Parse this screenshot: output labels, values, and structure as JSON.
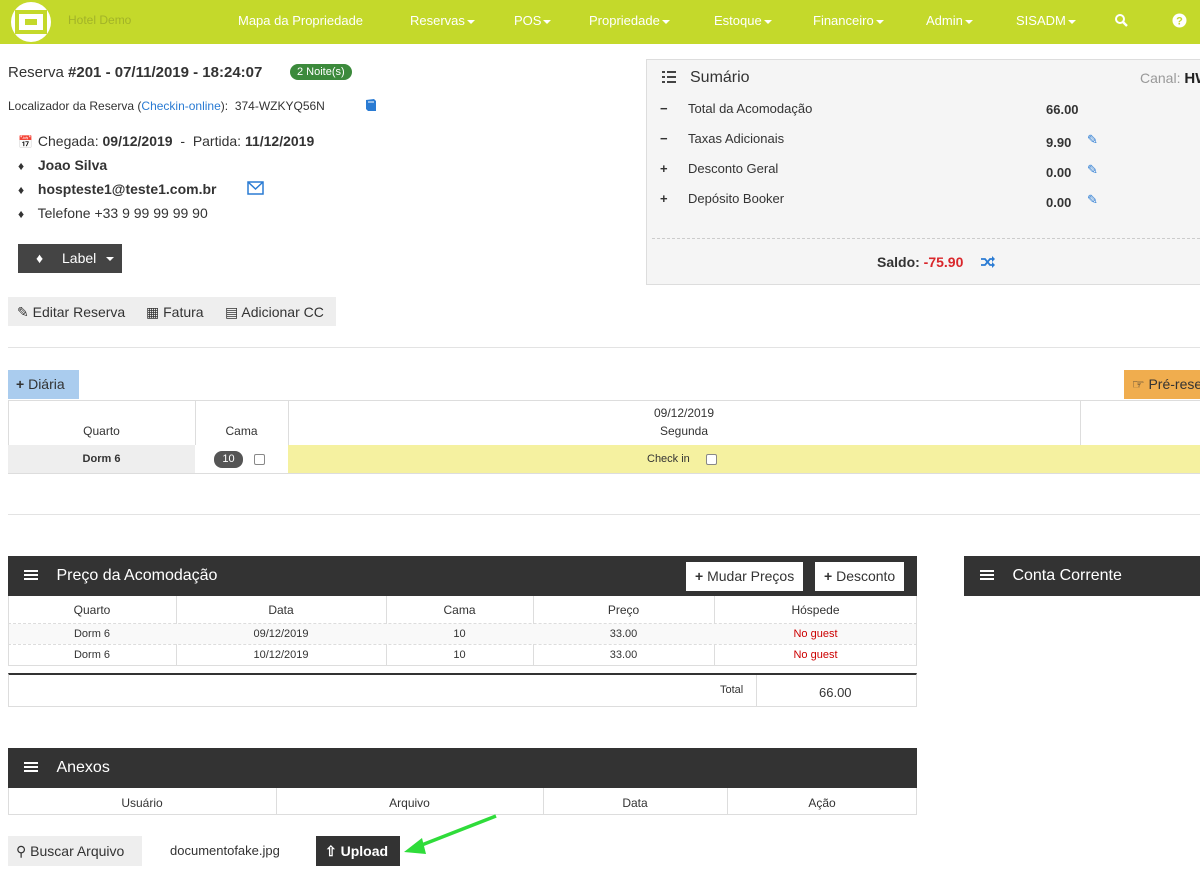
{
  "navbar": {
    "brand": "Hotel Demo",
    "items": [
      "Mapa da Propriedade",
      "Reservas",
      "POS",
      "Propriedade",
      "Estoque",
      "Financeiro",
      "Admin",
      "SISADM"
    ]
  },
  "reservation": {
    "title_prefix": "Reserva ",
    "title_main": "#201 - 07/11/2019 - 18:24:07",
    "nights_badge": "2 Noite(s)",
    "locator_label": "Localizador da Reserva (",
    "locator_link": "Checkin-online",
    "locator_suffix": "):",
    "locator_code": "374-WZKYQ56N",
    "checkin_label": "Chegada: ",
    "checkin_date": "09/12/2019",
    "sep": "  -  ",
    "checkout_label": "Partida: ",
    "checkout_date": "11/12/2019",
    "guest_name": "Joao Silva",
    "email": "hospteste1@teste1.com.br",
    "phone": "Telefone +33 9 99 99 99 90",
    "label_button": "Label"
  },
  "toolbar": {
    "edit": "Editar Reserva",
    "invoice": "Fatura",
    "add_cc": "Adicionar CC"
  },
  "summary": {
    "title": "Sumário",
    "canal_label": "Canal: ",
    "canal_value": "HW",
    "rows": [
      {
        "sign": "−",
        "label": "Total da Acomodação",
        "value": "66.00"
      },
      {
        "sign": "−",
        "label": "Taxas Adicionais",
        "value": "9.90"
      },
      {
        "sign": "+",
        "label": "Desconto Geral",
        "value": "0.00"
      },
      {
        "sign": "+",
        "label": "Depósito Booker",
        "value": "0.00"
      }
    ],
    "saldo_label": "Saldo: ",
    "saldo_value": "-75.90"
  },
  "daily": {
    "add_button": "Diária",
    "pre_button": "Pré-rese",
    "col_room": "Quarto",
    "col_bed": "Cama",
    "date": "09/12/2019",
    "weekday": "Segunda",
    "room": "Dorm 6",
    "bed": "10",
    "status": "Check in"
  },
  "price_panel": {
    "title": "Preço da Acomodação",
    "change_prices": "Mudar Preços",
    "discount": "Desconto",
    "headers": [
      "Quarto",
      "Data",
      "Cama",
      "Preço",
      "Hóspede"
    ],
    "rows": [
      [
        "Dorm 6",
        "09/12/2019",
        "10",
        "33.00",
        "No guest"
      ],
      [
        "Dorm 6",
        "10/12/2019",
        "10",
        "33.00",
        "No guest"
      ]
    ],
    "total_label": "Total",
    "total_value": "66.00"
  },
  "account_panel": {
    "title": "Conta Corrente"
  },
  "attachments": {
    "title": "Anexos",
    "headers": [
      "Usuário",
      "Arquivo",
      "Data",
      "Ação"
    ],
    "search_button": "Buscar Arquivo",
    "filename": "documentofake.jpg",
    "upload_button": "Upload"
  }
}
